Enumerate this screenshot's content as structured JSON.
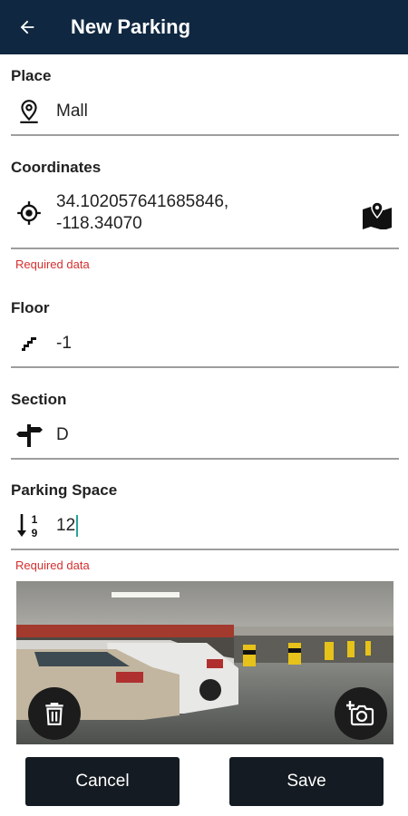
{
  "appbar": {
    "title": "New Parking"
  },
  "place": {
    "label": "Place",
    "value": "Mall"
  },
  "coordinates": {
    "label": "Coordinates",
    "line1": "34.102057641685846,",
    "line2": "-118.34070",
    "error": "Required data"
  },
  "floor": {
    "label": "Floor",
    "value": "-1"
  },
  "section": {
    "label": "Section",
    "value": "D"
  },
  "parking_space": {
    "label": "Parking Space",
    "value": "12",
    "error": "Required data"
  },
  "actions": {
    "cancel": "Cancel",
    "save": "Save"
  },
  "colors": {
    "appbar": "#0f2740",
    "error": "#d32f2f",
    "cursor": "#26a69a",
    "button": "#141b22"
  }
}
